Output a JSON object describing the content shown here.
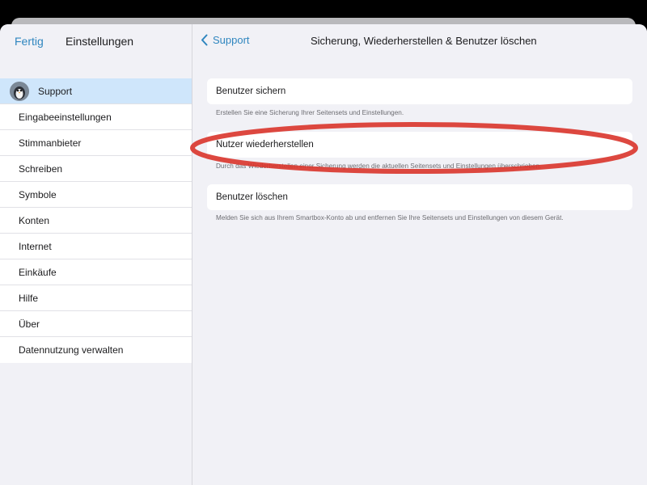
{
  "sidebar": {
    "done_label": "Fertig",
    "title": "Einstellungen",
    "items": [
      {
        "label": "Support"
      },
      {
        "label": "Eingabeeinstellungen"
      },
      {
        "label": "Stimmanbieter"
      },
      {
        "label": "Schreiben"
      },
      {
        "label": "Symbole"
      },
      {
        "label": "Konten"
      },
      {
        "label": "Internet"
      },
      {
        "label": "Einkäufe"
      },
      {
        "label": "Hilfe"
      },
      {
        "label": "Über"
      },
      {
        "label": "Datennutzung verwalten"
      }
    ]
  },
  "detail": {
    "back_label": "Support",
    "title": "Sicherung, Wiederherstellen & Benutzer löschen",
    "options": [
      {
        "label": "Benutzer sichern",
        "description": "Erstellen Sie eine Sicherung Ihrer Seitensets und Einstellungen."
      },
      {
        "label": "Nutzer wiederherstellen",
        "description": "Durch das Wiederherstellen einer Sicherung werden die aktuellen Seitensets und Einstellungen überschrieben."
      },
      {
        "label": "Benutzer löschen",
        "description": "Melden Sie sich aus Ihrem Smartbox-Konto ab und entfernen Sie Ihre Seitensets und Einstellungen von diesem Gerät."
      }
    ]
  },
  "colors": {
    "accent": "#2f86bf",
    "selected_row": "#cfe6fb",
    "annotation_red": "#d9342b"
  },
  "icons": {
    "back": "chevron-left-icon",
    "avatar": "penguin-avatar-icon"
  }
}
